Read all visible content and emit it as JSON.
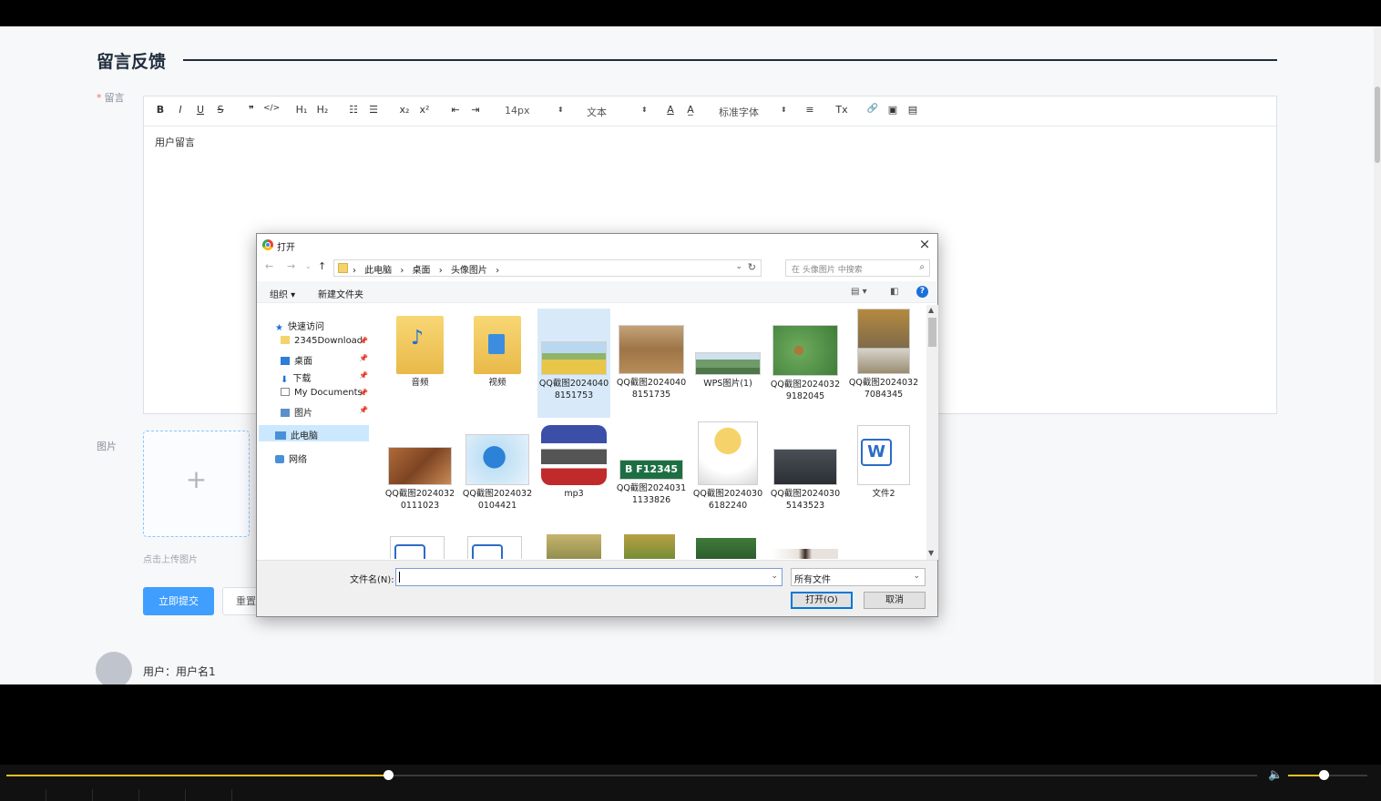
{
  "form": {
    "section_title": "留言反馈",
    "message_label": "留言",
    "required_mark": "*",
    "image_label": "图片",
    "upload_hint": "点击上传图片",
    "upload_plus": "+",
    "submit_label": "立即提交",
    "reset_label": "重置"
  },
  "editor": {
    "content": "用户留言",
    "toolbar": {
      "bold": "B",
      "italic": "I",
      "underline": "U",
      "strike": "S",
      "quote": "❞",
      "code": "</>",
      "h1": "H₁",
      "h2": "H₂",
      "ordered_list": "☷",
      "bullet_list": "☰",
      "subscript": "x₂",
      "superscript": "x²",
      "outdent": "⇤",
      "indent": "⇥",
      "size_value": "14px",
      "paragraph_value": "文本",
      "font_value": "标准字体",
      "color": "A",
      "background": "A̲",
      "align": "≡",
      "clean": "Tx",
      "link": "🔗",
      "image": "▣",
      "video": "▤"
    }
  },
  "comment": {
    "user_label": "用户：用户名1"
  },
  "dialog": {
    "title": "打开",
    "close": "×",
    "breadcrumbs": [
      "此电脑",
      "桌面",
      "头像图片"
    ],
    "search_placeholder": "在 头像图片 中搜索",
    "organize": "组织 ▾",
    "new_folder": "新建文件夹",
    "help": "?",
    "nav": {
      "quick_access": "快速访问",
      "items": [
        "2345Download",
        "桌面",
        "下载",
        "My Documents",
        "图片"
      ],
      "this_pc": "此电脑",
      "network": "网络"
    },
    "files": [
      {
        "name": "音频",
        "kind": "folder-audio"
      },
      {
        "name": "视频",
        "kind": "folder-video"
      },
      {
        "name": "QQ截图20240408151753",
        "kind": "field"
      },
      {
        "name": "QQ截图20240408151735",
        "kind": "wheat"
      },
      {
        "name": "WPS图片(1)",
        "kind": "village"
      },
      {
        "name": "QQ截图20240329182045",
        "kind": "frogs"
      },
      {
        "name": "QQ截图20240327084345",
        "kind": "horse"
      },
      {
        "name": "QQ截图20240320111023",
        "kind": "straw"
      },
      {
        "name": "QQ截图20240320104421",
        "kind": "player"
      },
      {
        "name": "mp3",
        "kind": "mp3"
      },
      {
        "name": "QQ截图20240311133826",
        "kind": "plate"
      },
      {
        "name": "QQ截图20240306182240",
        "kind": "anime"
      },
      {
        "name": "QQ截图20240305143523",
        "kind": "road"
      },
      {
        "name": "文件2",
        "kind": "word"
      }
    ],
    "plate_text": "B F12345",
    "word_letter": "W",
    "filename_label": "文件名(N):",
    "filetype": "所有文件",
    "open_button": "打开(O)",
    "cancel_button": "取消"
  },
  "player": {
    "progress": 0.305,
    "volume": 0.45,
    "accent": "#e8c020"
  }
}
